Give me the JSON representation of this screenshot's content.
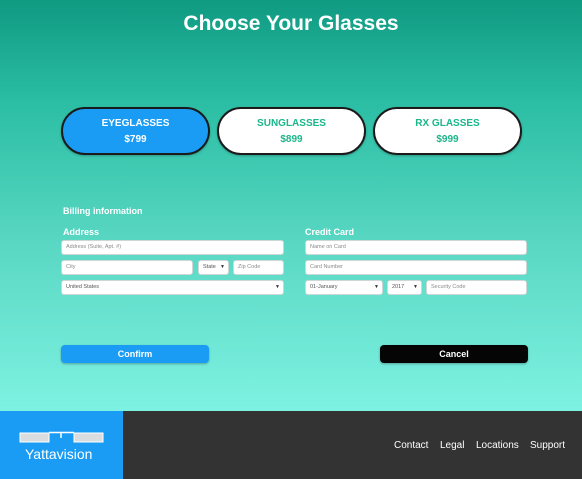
{
  "page": {
    "title": "Choose Your Glasses"
  },
  "options": [
    {
      "name": "EYEGLASSES",
      "price": "$799",
      "selected": true
    },
    {
      "name": "SUNGLASSES",
      "price": "$899",
      "selected": false
    },
    {
      "name": "RX GLASSES",
      "price": "$999",
      "selected": false
    }
  ],
  "billing": {
    "title": "Billing information",
    "address": {
      "label": "Address",
      "street_placeholder": "Address (Suite, Apt. #)",
      "city_placeholder": "City",
      "state_value": "State",
      "zip_placeholder": "Zip Code",
      "country_value": "United States"
    },
    "card": {
      "label": "Credit Card",
      "name_placeholder": "Name on Card",
      "number_placeholder": "Card Number",
      "month_value": "01-January",
      "year_value": "2017",
      "security_placeholder": "Security Code"
    }
  },
  "actions": {
    "confirm_label": "Confirm",
    "cancel_label": "Cancel"
  },
  "footer": {
    "logo_text": "Yattavision",
    "links": [
      "Contact",
      "Legal",
      "Locations",
      "Support"
    ]
  },
  "colors": {
    "accent": "#1a9cf5",
    "option_text": "#1bb68a",
    "footer_bg": "#333333",
    "cancel_bg": "#050505"
  }
}
